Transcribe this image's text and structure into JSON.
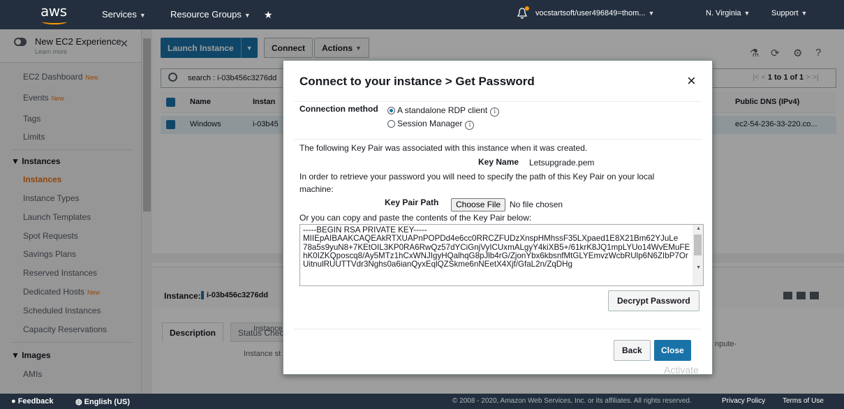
{
  "topnav": {
    "logo": "aws",
    "services": "Services",
    "resource_groups": "Resource Groups",
    "pin_icon": "pin-icon",
    "bell_icon": "bell-icon",
    "account": "vocstartsoft/user496849=thom...",
    "region": "N. Virginia",
    "support": "Support"
  },
  "sidebar": {
    "experience_title": "New EC2 Experience",
    "experience_learn": "Learn more",
    "items": [
      {
        "label": "EC2 Dashboard",
        "badge": "New"
      },
      {
        "label": "Events",
        "badge": "New"
      },
      {
        "label": "Tags",
        "badge": ""
      },
      {
        "label": "Limits",
        "badge": ""
      }
    ],
    "instances_section": "Instances",
    "instances_items": [
      {
        "label": "Instances",
        "badge": ""
      },
      {
        "label": "Instance Types",
        "badge": ""
      },
      {
        "label": "Launch Templates",
        "badge": ""
      },
      {
        "label": "Spot Requests",
        "badge": ""
      },
      {
        "label": "Savings Plans",
        "badge": ""
      },
      {
        "label": "Reserved Instances",
        "badge": ""
      },
      {
        "label": "Dedicated Hosts",
        "badge": "New"
      },
      {
        "label": "Scheduled Instances",
        "badge": ""
      },
      {
        "label": "Capacity Reservations",
        "badge": ""
      }
    ],
    "images_section": "Images",
    "images_items": [
      {
        "label": "AMIs",
        "badge": ""
      }
    ]
  },
  "toolbar": {
    "launch": "Launch Instance",
    "connect": "Connect",
    "actions": "Actions"
  },
  "search": {
    "value": "search : i-03b456c3276dd"
  },
  "pager": {
    "text": "1 to 1 of 1"
  },
  "table": {
    "headers": [
      "Name",
      "Instan",
      "Public DNS (IPv4)"
    ],
    "row": [
      "Windows",
      "i-03b45",
      "ec2-54-236-33-220.co..."
    ]
  },
  "detail": {
    "instance_label": "Instance:",
    "instance_id": "i-03b456c3276dd",
    "tab_description": "Description",
    "tab_status": "Status Chec",
    "line1": "Instance",
    "line2": "Instance st",
    "line3": "npute-"
  },
  "modal": {
    "title": "Connect to your instance > Get Password",
    "connection_method_label": "Connection method",
    "option_rdp": "A standalone RDP client",
    "option_ssm": "Session Manager",
    "associated_text": "The following Key Pair was associated with this instance when it was created.",
    "key_name_label": "Key Name",
    "key_name_value": "Letsupgrade.pem",
    "retrieve_text_1": "In order to retrieve your password you will need to specify the path of this Key Pair on your local",
    "retrieve_text_2": "machine:",
    "key_pair_path_label": "Key Pair Path",
    "choose_file": "Choose File",
    "no_file": "No file chosen",
    "paste_text": "Or you can copy and paste the contents of the Key Pair below:",
    "key_contents": "-----BEGIN RSA PRIVATE KEY-----\nMIIEpAIBAAKCAQEAkRTXUAPnPOPDd4e6cc0RRCZFUDzXnspHMhssF35LXpaed1E8X21Bm62YJuLe\n78a5s9yuN8+7KEtOIL3KP0RA6RwQz57dYCiGnjVyICUxmALgyY4kiXB5+/61krK8JQ1mpLYUo14WvEMuFEhK0IZKQposcq8/Ay5MTz1hCxWNJIgyHQalhqG8pJlb4rG/ZjonYbx6kbsnfMtGLYEmvzWcbRUlp6N6ZIbP7OrUitnulRUUTTVdr3Nghs0a6ianQyxEqlQZSkme6nNEetX4Xjf/GfaL2n/ZqDHg",
    "decrypt": "Decrypt Password",
    "back": "Back",
    "close": "Close",
    "watermark": "Activate"
  },
  "footer": {
    "feedback": "Feedback",
    "language": "English (US)",
    "copyright": "© 2008 - 2020, Amazon Web Services, Inc. or its affiliates. All rights reserved.",
    "privacy": "Privacy Policy",
    "terms": "Terms of Use"
  }
}
